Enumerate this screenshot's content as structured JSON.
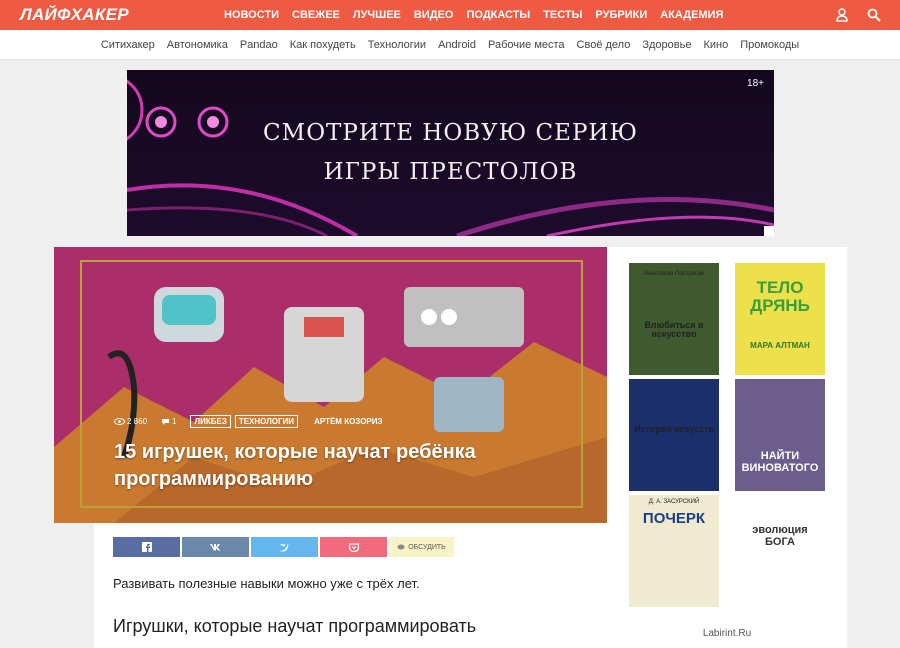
{
  "header": {
    "logo": "ЛАЙФХАКЕР",
    "nav": [
      "НОВОСТИ",
      "СВЕЖЕЕ",
      "ЛУЧШЕЕ",
      "ВИДЕО",
      "ПОДКАСТЫ",
      "ТЕСТЫ",
      "РУБРИКИ",
      "АКАДЕМИЯ"
    ],
    "accent": "#ee5a42"
  },
  "subnav": [
    "Ситихакер",
    "Автономика",
    "Pandao",
    "Как похудеть",
    "Технологии",
    "Android",
    "Рабочие места",
    "Своё дело",
    "Здоровье",
    "Кино",
    "Промокоды"
  ],
  "banner": {
    "age": "18+",
    "line1": "СМОТРИТЕ НОВУЮ СЕРИЮ",
    "line2": "ИГРЫ ПРЕСТОЛОВ"
  },
  "article": {
    "views": "2 860",
    "comments": "1",
    "tags": [
      "ЛИКБЕЗ",
      "ТЕХНОЛОГИИ"
    ],
    "author": "АРТЁМ КОЗОРИЗ",
    "title": "15 игрушек, которые научат ребёнка программированию",
    "share_discuss": "ОБСУДИТЬ",
    "lead": "Развивать полезные навыки можно уже с трёх лет.",
    "subheading": "Игрушки, которые научат программировать"
  },
  "side_ad": {
    "source": "Labirint.Ru",
    "books": [
      {
        "title": "Влюбиться в искусство",
        "author": "Анастасия Постригай",
        "color": "#3f5a2f"
      },
      {
        "title": "ТЕЛО ДРЯНЬ",
        "author": "МАРА АЛТМАН",
        "color": "#eee04a"
      },
      {
        "title": "История искусств",
        "author": "",
        "color": "#1b2f6d"
      },
      {
        "title": "НАЙТИ ВИНОВАТОГО",
        "author": "",
        "color": "#6b5d8c"
      },
      {
        "title": "ПОЧЕРК",
        "author": "Д. А. ЗАСУРСКИЙ",
        "color": "#f0ead0"
      },
      {
        "title": "эволюция БОГА",
        "author": "",
        "color": "#ffffff"
      }
    ]
  }
}
